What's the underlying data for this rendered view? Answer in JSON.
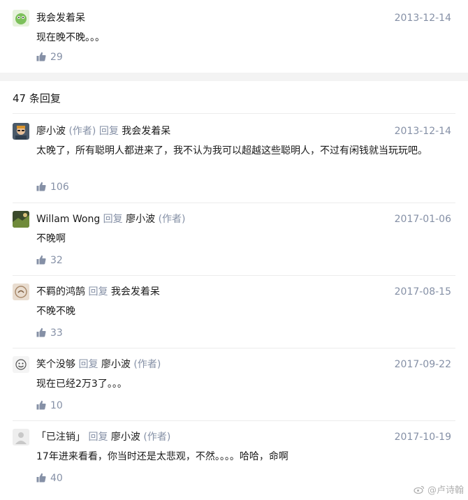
{
  "top_comment": {
    "name": "我会发着呆",
    "date": "2013-12-14",
    "text": "现在晚不晚。。。",
    "likes": "29"
  },
  "reply_count": "47 条回复",
  "reply_word": "回复",
  "author_tag": "(作者)",
  "comments": [
    {
      "name": "廖小波",
      "is_author": true,
      "reply_to": "我会发着呆",
      "reply_to_is_author": false,
      "date": "2013-12-14",
      "text": "太晚了，所有聪明人都进来了，我不认为我可以超越这些聪明人，不过有闲钱就当玩玩吧。",
      "likes": "106"
    },
    {
      "name": "Willam Wong",
      "is_author": false,
      "reply_to": "廖小波",
      "reply_to_is_author": true,
      "date": "2017-01-06",
      "text": "不晚啊",
      "likes": "32"
    },
    {
      "name": "不羁的鸿鹄",
      "is_author": false,
      "reply_to": "我会发着呆",
      "reply_to_is_author": false,
      "date": "2017-08-15",
      "text": "不晚不晚",
      "likes": "33"
    },
    {
      "name": "笑个没够",
      "is_author": false,
      "reply_to": "廖小波",
      "reply_to_is_author": true,
      "date": "2017-09-22",
      "text": "现在已经2万3了。。。",
      "likes": "10"
    },
    {
      "name": "「已注销」",
      "is_author": false,
      "reply_to": "廖小波",
      "reply_to_is_author": true,
      "date": "2017-10-19",
      "text": "17年进来看看，你当时还是太悲观，不然。。。。哈哈，命啊",
      "likes": "40"
    }
  ],
  "watermark": "@卢诗翰",
  "colors": {
    "meta_gray": "#8590a6",
    "divider": "#ececec",
    "gap_bg": "#f3f3f3"
  },
  "icons": {
    "like": "thumbs-up-icon",
    "watermark": "weibo-icon"
  }
}
